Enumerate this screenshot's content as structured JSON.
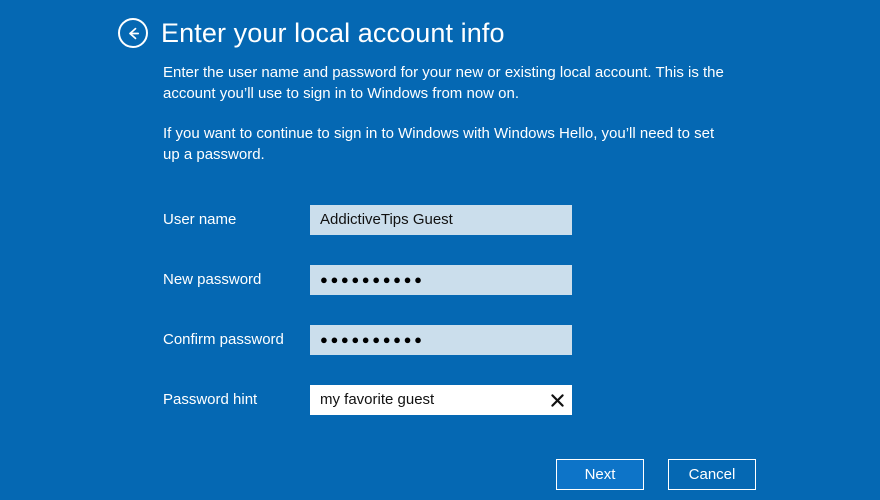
{
  "theme": {
    "background": "#0568b3",
    "field_background": "#cbdeec",
    "field_background_focused": "#ffffff",
    "text_on_blue": "#ffffff",
    "primary_button_fill": "#0d74c8"
  },
  "header": {
    "back_icon": "back-arrow-icon",
    "title": "Enter your local account info"
  },
  "intro": {
    "paragraph1": "Enter the user name and password for your new or existing local account. This is the account you’ll use to sign in to Windows from now on.",
    "paragraph2": "If you want to continue to sign in to Windows with Windows Hello, you’ll need to set up a password."
  },
  "form": {
    "fields": [
      {
        "label": "User name",
        "value": "AddictiveTips Guest",
        "placeholder": "",
        "masked": false,
        "focused": false,
        "has_clear": false
      },
      {
        "label": "New password",
        "value": "●●●●●●●●●●",
        "placeholder": "",
        "masked": true,
        "focused": false,
        "has_clear": false
      },
      {
        "label": "Confirm password",
        "value": "●●●●●●●●●●",
        "placeholder": "",
        "masked": true,
        "focused": false,
        "has_clear": false
      },
      {
        "label": "Password hint",
        "value": "my favorite guest",
        "placeholder": "",
        "masked": false,
        "focused": true,
        "has_clear": true,
        "clear_icon": "clear-x-icon"
      }
    ]
  },
  "buttons": {
    "next_label": "Next",
    "cancel_label": "Cancel"
  }
}
